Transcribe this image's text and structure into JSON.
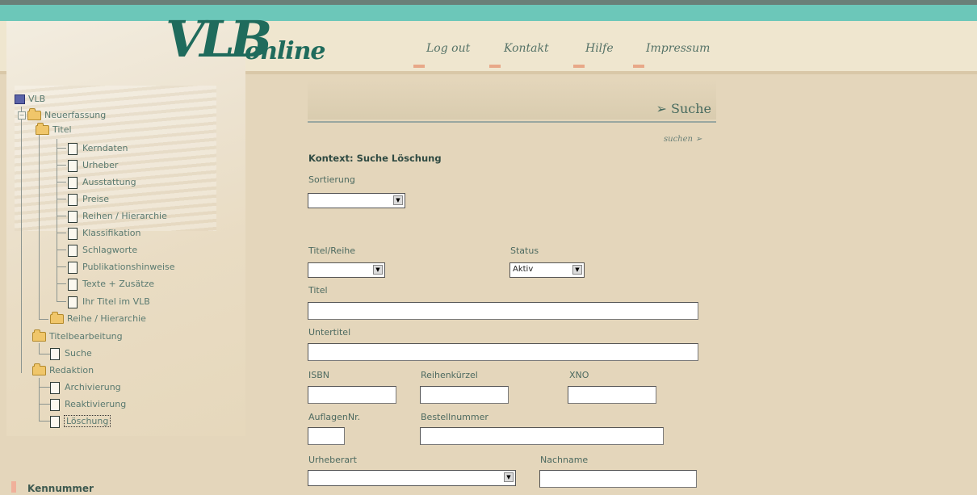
{
  "header": {
    "logo_main": "VLB",
    "logo_sub": "online",
    "nav": [
      "Log out",
      "Kontakt",
      "Hilfe",
      "Impressum"
    ]
  },
  "tree": {
    "root": "VLB",
    "neuerfassung": "Neuerfassung",
    "titel": "Titel",
    "titel_items": [
      "Kerndaten",
      "Urheber",
      "Ausstattung",
      "Preise",
      "Reihen / Hierarchie",
      "Klassifikation",
      "Schlagworte",
      "Publikationshinweise",
      "Texte + Zusätze",
      "Ihr Titel im VLB"
    ],
    "reihe_hierarchie": "Reihe / Hierarchie",
    "titelbearbeitung": "Titelbearbeitung",
    "suche": "Suche",
    "redaktion": "Redaktion",
    "redaktion_items": [
      "Archivierung",
      "Reaktivierung",
      "Löschung"
    ]
  },
  "sidebar": {
    "kennummer": "Kennummer"
  },
  "main": {
    "page_title": "➢ Suche",
    "suchen_link": "suchen ➢",
    "context": "Kontext: Suche Löschung",
    "sortierung_label": "Sortierung",
    "titel_reihe_label": "Titel/Reihe",
    "status_label": "Status",
    "status_value": "Aktiv",
    "titel_label": "Titel",
    "untertitel_label": "Untertitel",
    "isbn_label": "ISBN",
    "reihenkuerzel_label": "Reihenkürzel",
    "xno_label": "XNO",
    "auflagennr_label": "AuflagenNr.",
    "bestellnummer_label": "Bestellnummer",
    "urheberart_label": "Urheberart",
    "nachname_label": "Nachname"
  },
  "colors": {
    "background": "#e4d6bb",
    "teal": "#6cc7b9",
    "logo": "#1f6b5c"
  }
}
